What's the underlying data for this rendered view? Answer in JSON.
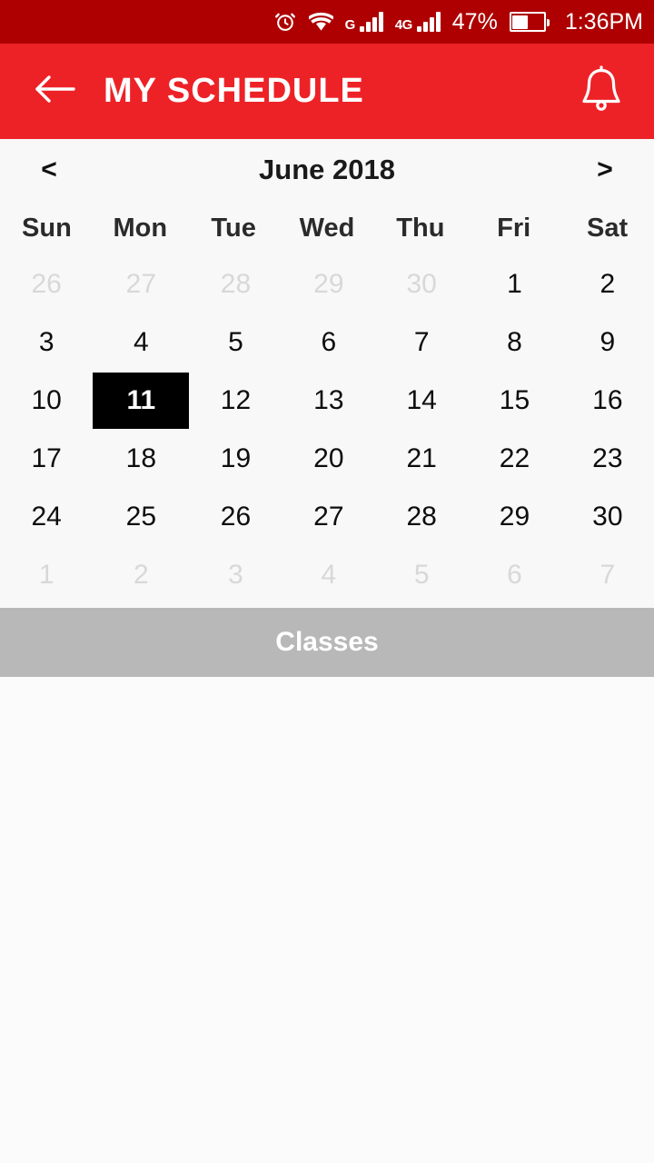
{
  "status_bar": {
    "background": "#ae0000",
    "icons": [
      "alarm-icon",
      "wifi-icon",
      "signal-g-icon",
      "signal-4g-icon"
    ],
    "network_1_label": "G",
    "network_2_label": "4G",
    "battery_percent": "47%",
    "time": "1:36PM"
  },
  "app_bar": {
    "background": "#ed2227",
    "back_icon": "back-arrow-icon",
    "title": "MY SCHEDULE",
    "notification_icon": "bell-icon"
  },
  "calendar": {
    "prev_label": "<",
    "next_label": ">",
    "month_title": "June 2018",
    "weekdays": [
      "Sun",
      "Mon",
      "Tue",
      "Wed",
      "Thu",
      "Fri",
      "Sat"
    ],
    "selected_day": 11,
    "weeks": [
      [
        {
          "label": "26",
          "muted": true
        },
        {
          "label": "27",
          "muted": true
        },
        {
          "label": "28",
          "muted": true
        },
        {
          "label": "29",
          "muted": true
        },
        {
          "label": "30",
          "muted": true
        },
        {
          "label": "1",
          "muted": false
        },
        {
          "label": "2",
          "muted": false
        }
      ],
      [
        {
          "label": "3",
          "muted": false
        },
        {
          "label": "4",
          "muted": false
        },
        {
          "label": "5",
          "muted": false
        },
        {
          "label": "6",
          "muted": false
        },
        {
          "label": "7",
          "muted": false
        },
        {
          "label": "8",
          "muted": false
        },
        {
          "label": "9",
          "muted": false
        }
      ],
      [
        {
          "label": "10",
          "muted": false
        },
        {
          "label": "11",
          "muted": false,
          "selected": true
        },
        {
          "label": "12",
          "muted": false
        },
        {
          "label": "13",
          "muted": false
        },
        {
          "label": "14",
          "muted": false
        },
        {
          "label": "15",
          "muted": false
        },
        {
          "label": "16",
          "muted": false
        }
      ],
      [
        {
          "label": "17",
          "muted": false
        },
        {
          "label": "18",
          "muted": false
        },
        {
          "label": "19",
          "muted": false
        },
        {
          "label": "20",
          "muted": false
        },
        {
          "label": "21",
          "muted": false
        },
        {
          "label": "22",
          "muted": false
        },
        {
          "label": "23",
          "muted": false
        }
      ],
      [
        {
          "label": "24",
          "muted": false
        },
        {
          "label": "25",
          "muted": false
        },
        {
          "label": "26",
          "muted": false
        },
        {
          "label": "27",
          "muted": false
        },
        {
          "label": "28",
          "muted": false
        },
        {
          "label": "29",
          "muted": false
        },
        {
          "label": "30",
          "muted": false
        }
      ],
      [
        {
          "label": "1",
          "muted": true
        },
        {
          "label": "2",
          "muted": true
        },
        {
          "label": "3",
          "muted": true
        },
        {
          "label": "4",
          "muted": true
        },
        {
          "label": "5",
          "muted": true
        },
        {
          "label": "6",
          "muted": true
        },
        {
          "label": "7",
          "muted": true
        }
      ]
    ]
  },
  "section": {
    "title": "Classes",
    "background": "#b8b8b8"
  },
  "content": {
    "items": []
  }
}
